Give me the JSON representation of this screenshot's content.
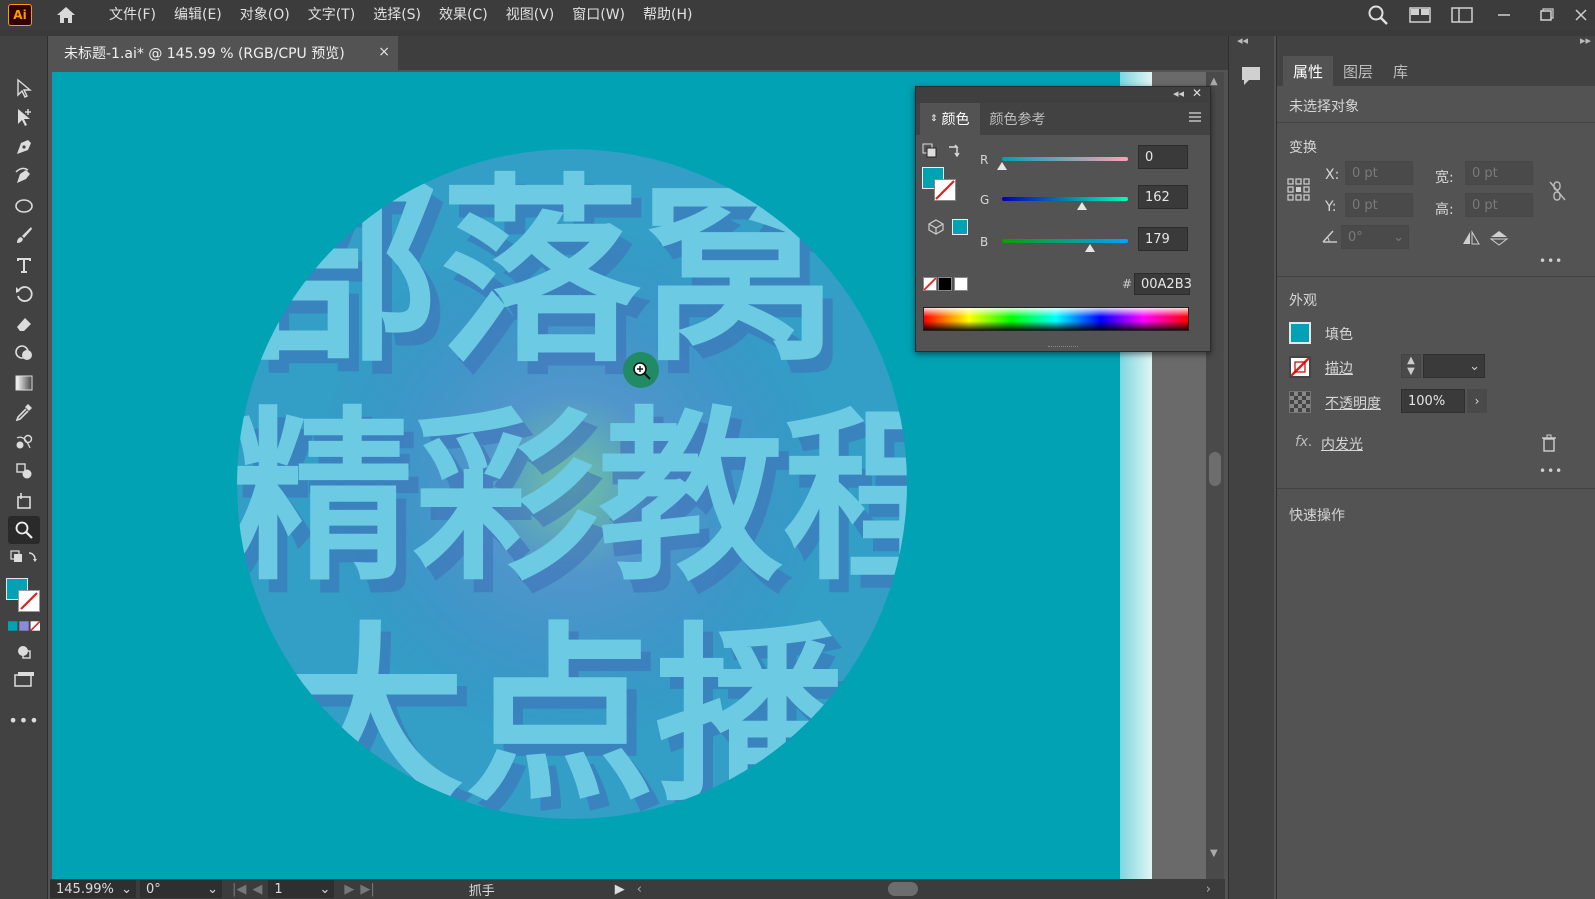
{
  "app": {
    "logo_text": "Ai"
  },
  "menu": [
    "文件(F)",
    "编辑(E)",
    "对象(O)",
    "文字(T)",
    "选择(S)",
    "效果(C)",
    "视图(V)",
    "窗口(W)",
    "帮助(H)"
  ],
  "document": {
    "tab_title": "未标题-1.ai* @ 145.99 % (RGB/CPU 预览)",
    "close": "×"
  },
  "artwork": {
    "background": "#00a2b3",
    "text_color": "#6ccbe3",
    "lines": [
      "部落窝",
      "精彩教程",
      "大点播"
    ]
  },
  "status": {
    "zoom": "145.99%",
    "rotation": "0°",
    "artboard": "1",
    "tool_name": "抓手"
  },
  "color_panel": {
    "tabs": [
      "颜色",
      "颜色参考"
    ],
    "fill_color": "#00a2b3",
    "r_label": "R",
    "r": "0",
    "r_fraction": 0.0,
    "g_label": "G",
    "g": "162",
    "g_fraction": 0.635,
    "b_label": "B",
    "b": "179",
    "b_fraction": 0.702,
    "hash": "#",
    "hex": "00A2B3"
  },
  "properties": {
    "tabs": [
      "属性",
      "图层",
      "库"
    ],
    "no_selection": "未选择对象",
    "transform_title": "变换",
    "x_label": "X:",
    "x_value": "0 pt",
    "y_label": "Y:",
    "y_value": "0 pt",
    "w_label": "宽:",
    "w_value": "0 pt",
    "h_label": "高:",
    "h_value": "0 pt",
    "angle_value": "0°",
    "appearance_title": "外观",
    "fill_label": "填色",
    "stroke_label": "描边",
    "opacity_label": "不透明度",
    "opacity_value": "100%",
    "fx_label": "fx.",
    "effect_name": "内发光",
    "quick_actions_title": "快速操作",
    "more": "•••"
  },
  "colors": {
    "accent": "#00a2b3",
    "ui_dark": "#3c3c3c",
    "panel": "#535353"
  }
}
